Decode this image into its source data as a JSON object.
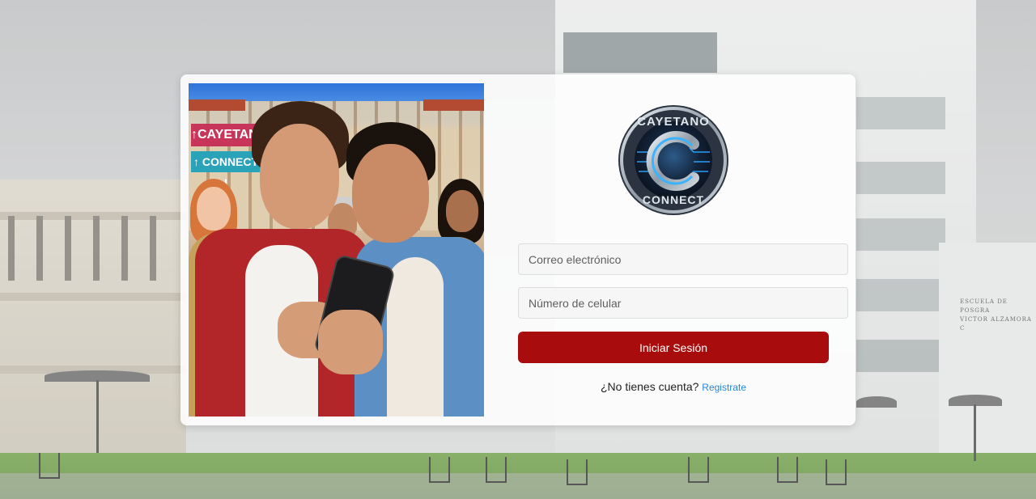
{
  "hero": {
    "sign_line1": "↑CAYETANO",
    "sign_line2": "↑ CONNECT !"
  },
  "logo": {
    "text_top": "CAYETANO",
    "text_bottom": "CONNECT",
    "colors": {
      "ring": "#1b2a3c",
      "circuit": "#2a9df4",
      "metal": "#b9c3cc"
    }
  },
  "background": {
    "building_sign_line1": "ESCUELA DE POSGRA",
    "building_sign_line2": "VICTOR ALZAMORA C"
  },
  "form": {
    "email_placeholder": "Correo electrónico",
    "phone_placeholder": "Número de celular",
    "login_label": "Iniciar Sesión",
    "no_account_text": "¿No tienes cuenta?",
    "register_link": "Registrate"
  },
  "colors": {
    "primary": "#a80c0c",
    "link": "#2b86d6"
  }
}
